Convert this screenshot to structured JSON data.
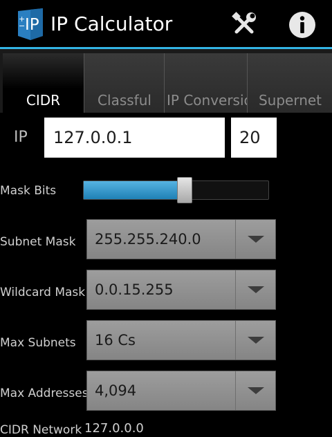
{
  "app": {
    "title": "IP Calculator",
    "logo_text": "IP",
    "icons": {
      "settings": "tools-icon",
      "info": "info-icon"
    },
    "accent_color": "#33b5e5"
  },
  "tabs": [
    {
      "label": "CIDR",
      "active": true
    },
    {
      "label": "Classful",
      "active": false
    },
    {
      "label": "IP  Conversion",
      "active": false
    },
    {
      "label": "Supernet",
      "active": false
    }
  ],
  "ip_row": {
    "label": "IP",
    "ip_value": "127.0.0.1",
    "bits_value": "20"
  },
  "mask_bits": {
    "label": "Mask Bits",
    "value": 20,
    "min": 8,
    "max": 30
  },
  "fields": {
    "subnet_mask": {
      "label": "Subnet Mask",
      "value": "255.255.240.0"
    },
    "wildcard_mask": {
      "label": "Wildcard Mask",
      "value": "0.0.15.255"
    },
    "max_subnets": {
      "label": "Max Subnets",
      "value": "16 Cs"
    },
    "max_addresses": {
      "label": "Max Addresses",
      "value": "4,094"
    }
  },
  "cidr_network": {
    "label": "CIDR Network",
    "value": "127.0.0.0"
  }
}
